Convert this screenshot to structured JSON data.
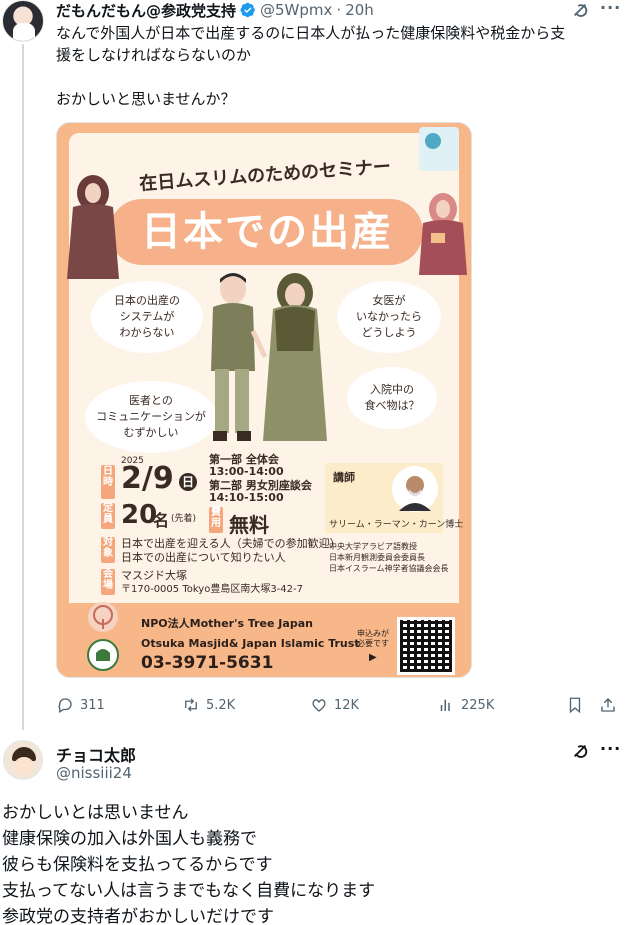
{
  "tweet": {
    "author_name": "だもんだもん@参政党支持",
    "handle": "@5Wpmx",
    "separator": "·",
    "time": "20h",
    "text_lines": [
      "なんで外国人が日本で出産するのに日本人が払った健康保険料や税金から支",
      "援をしなければならないのか"
    ],
    "text_line2": "おかしいと思いませんか？",
    "stats": {
      "replies": "311",
      "reposts": "5.2K",
      "likes": "12K",
      "views": "225K"
    }
  },
  "poster": {
    "subtitle": "在日ムスリムのためのセミナー",
    "title": "日本での出産",
    "bubbles": [
      "日本の出産の\nシステムが\nわからない",
      "女医が\nいなかったら\nどうしよう",
      "医者との\nコミュニケーションが\nむずかしい",
      "入院中の\n食べ物は？"
    ],
    "date_year": "2025",
    "date": "2/9",
    "date_day": "日",
    "tag_date": "日時",
    "session1_label": "第一部 全体会",
    "session1_time": "13:00-14:00",
    "session2_label": "第二部 男女別座談会",
    "session2_time": "14:10-15:00",
    "tag_capacity": "定員",
    "capacity": "20",
    "capacity_unit": "名",
    "capacity_note": "(先着)",
    "tag_fee": "費用",
    "fee": "無料",
    "tag_target": "対象",
    "target_line1": "日本で出産を迎える人（夫婦での参加歓迎）",
    "target_line2": "日本での出産について知りたい人",
    "tag_venue": "会場",
    "venue_name": "マスジド大塚",
    "venue_address": "〒170-0005 Tokyo豊島区南大塚3-42-7",
    "lecturer_label": "講師",
    "lecturer_name": "サリーム・ラーマン・カーン博士",
    "lecturer_titles": [
      "中央大学アラビア語教授",
      "日本新月観測委員会委員長",
      "日本イスラーム神学者協議会会長"
    ],
    "org_line1": "NPO法人Mother's Tree Japan",
    "org_line2": "Otsuka Masjid& Japan Islamic Trust",
    "phone": "03-3971-5631",
    "apply_note": "申込みが\n必要です"
  },
  "reply": {
    "author_name": "チョコ太郎",
    "handle": "@nissiii24",
    "lines": [
      "おかしいとは思いません",
      "健康保険の加入は外国人も義務で",
      "彼らも保険料を支払ってるからです",
      "支払ってない人は言うまでもなく自費になります",
      "参政党の支持者がおかしいだけです"
    ]
  },
  "colors": {
    "text": "#0f1419",
    "secondary": "#536471",
    "verified": "#1d9bf0",
    "poster_orange": "#f7b789"
  }
}
